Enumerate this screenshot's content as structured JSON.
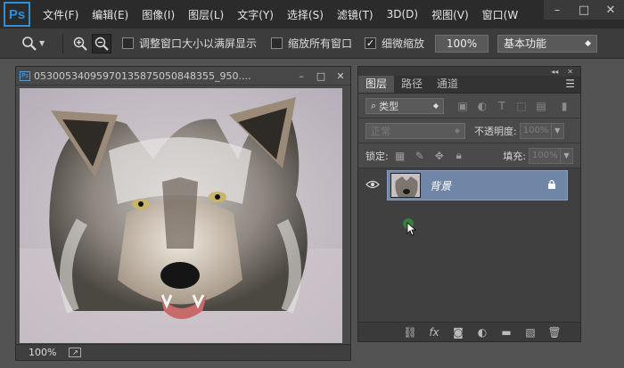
{
  "app": {
    "logo": "Ps"
  },
  "menu": {
    "items": [
      "文件(F)",
      "编辑(E)",
      "图像(I)",
      "图层(L)",
      "文字(Y)",
      "选择(S)",
      "滤镜(T)",
      "3D(D)",
      "视图(V)",
      "窗口(W"
    ],
    "window_controls": [
      "–",
      "□",
      "✕"
    ]
  },
  "options_bar": {
    "resize_windows_label": "调整窗口大小以满屏显示",
    "resize_windows_checked": false,
    "zoom_all_label": "缩放所有窗口",
    "zoom_all_checked": false,
    "scrubby_zoom_label": "细微缩放",
    "scrubby_zoom_checked": true,
    "zoom_percent": "100%",
    "workspace": "基本功能"
  },
  "document": {
    "title": "0530053409597013587505084835​5_950....",
    "zoom": "100%"
  },
  "layers_panel": {
    "tabs": [
      "图层",
      "路径",
      "通道"
    ],
    "active_tab": 0,
    "filter_type": "类型",
    "blend_mode": "正常",
    "opacity_label": "不透明度:",
    "opacity_value": "100%",
    "lock_label": "锁定:",
    "fill_label": "填充:",
    "fill_value": "100%",
    "layers": [
      {
        "name": "背景",
        "locked": true,
        "visible": true,
        "selected": true
      }
    ]
  },
  "colors": {
    "selection": "#6f86a6",
    "accent": "#2f8fd8"
  }
}
